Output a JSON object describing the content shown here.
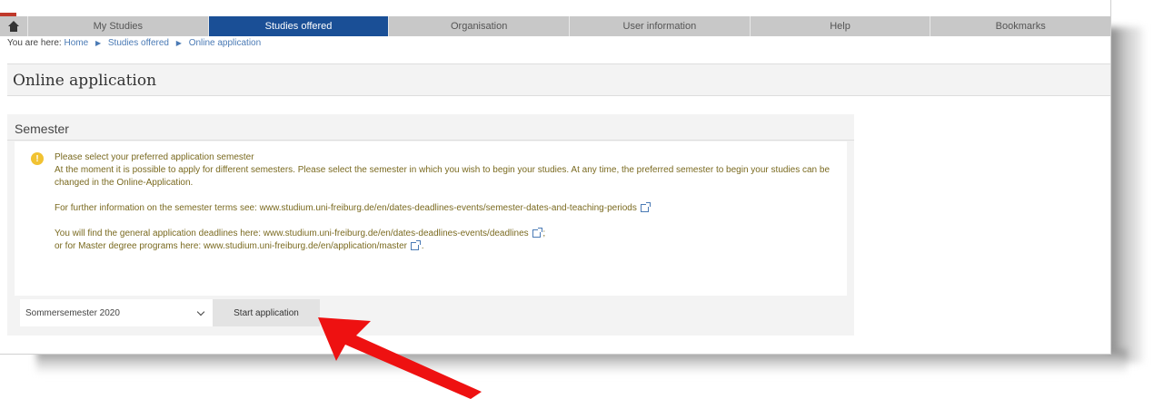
{
  "nav": {
    "tabs": [
      {
        "label": "My Studies"
      },
      {
        "label": "Studies offered"
      },
      {
        "label": "Organisation"
      },
      {
        "label": "User information"
      },
      {
        "label": "Help"
      },
      {
        "label": "Bookmarks"
      }
    ],
    "active_tab": "Studies offered"
  },
  "breadcrumb": {
    "prefix": "You are here:",
    "items": [
      "Home",
      "Studies offered",
      "Online application"
    ]
  },
  "page_title": "Online application",
  "section": {
    "title": "Semester",
    "info": {
      "heading": "Please select your preferred application semester",
      "para1": "At the moment it is possible to apply for different semesters. Please select the semester in which you wish to begin your studies. At any time, the preferred semester to begin your studies can be changed in the Online-Application.",
      "para2": "For further information on the semester terms see: www.studium.uni-freiburg.de/en/dates-deadlines-events/semester-dates-and-teaching-periods",
      "para3a": "You will find the general application deadlines here: www.studium.uni-freiburg.de/en/dates-deadlines-events/deadlines",
      "para3b": "or for Master degree programs here: www.studium.uni-freiburg.de/en/application/master"
    },
    "semester_select": "Sommersemester 2020",
    "start_button": "Start application"
  },
  "colors": {
    "nav_bg": "#c8c8c8",
    "active_tab": "#1a4f96",
    "arrow": "#ee1111",
    "info_icon": "#f1c232"
  }
}
